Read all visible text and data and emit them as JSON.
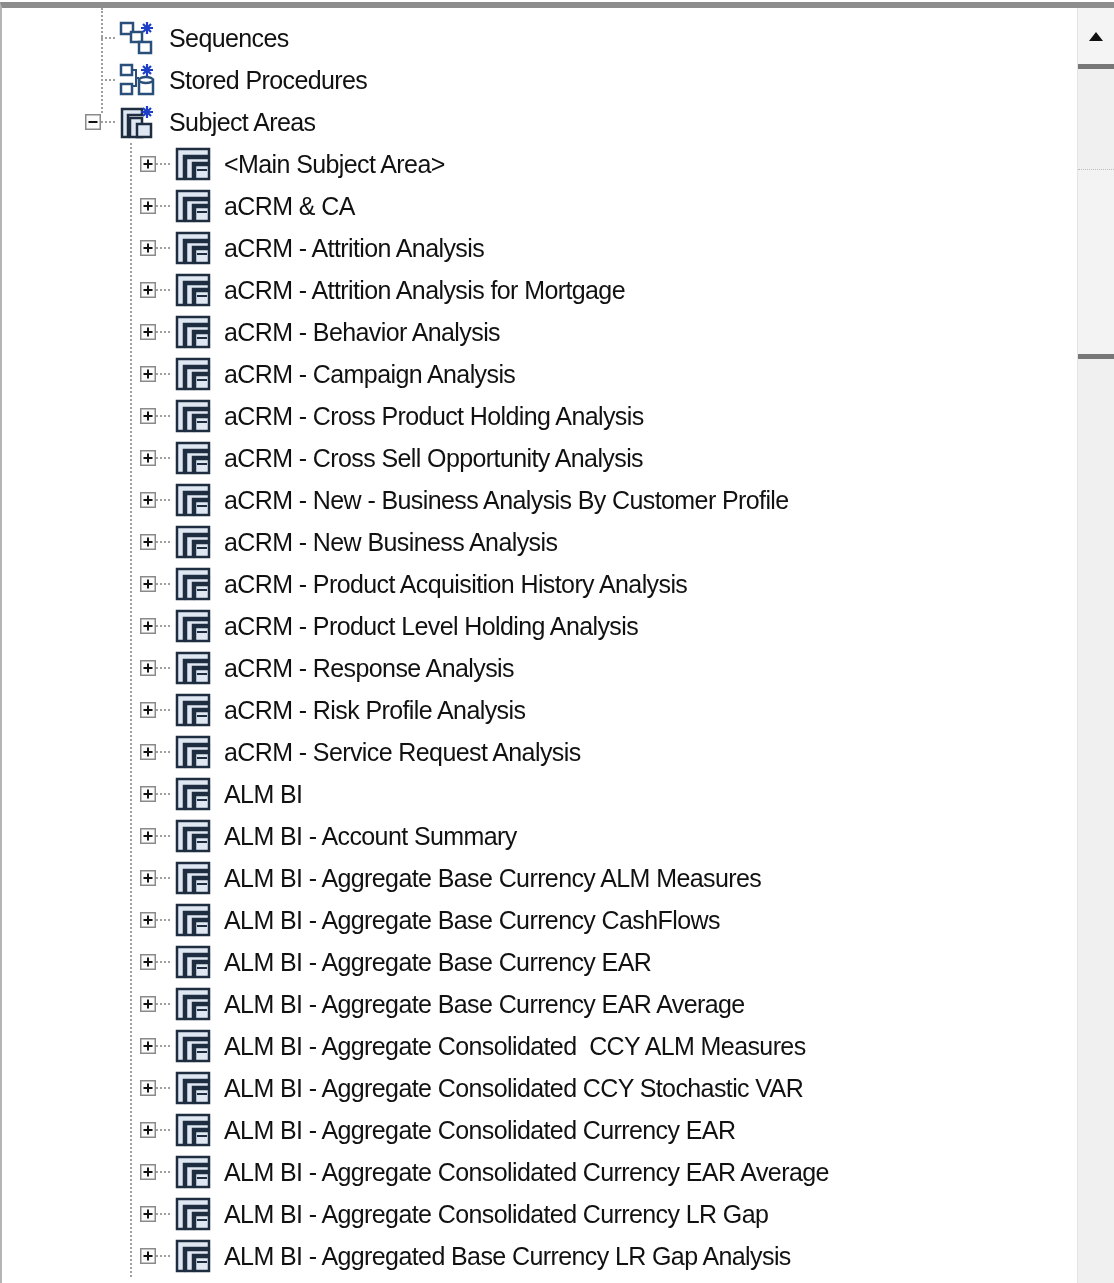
{
  "tree": {
    "items": [
      {
        "label": "Sequences",
        "kind": "sequences"
      },
      {
        "label": "Stored Procedures",
        "kind": "procedures"
      },
      {
        "label": "Subject Areas",
        "kind": "subject-folder",
        "expanded": true,
        "children": [
          {
            "label": "<Main Subject Area>",
            "kind": "subject-area",
            "expanded": false
          },
          {
            "label": "aCRM & CA",
            "kind": "subject-area",
            "expanded": false
          },
          {
            "label": "aCRM - Attrition Analysis",
            "kind": "subject-area",
            "expanded": false
          },
          {
            "label": "aCRM - Attrition Analysis for Mortgage",
            "kind": "subject-area",
            "expanded": false
          },
          {
            "label": "aCRM - Behavior Analysis",
            "kind": "subject-area",
            "expanded": false
          },
          {
            "label": "aCRM - Campaign Analysis",
            "kind": "subject-area",
            "expanded": false
          },
          {
            "label": "aCRM - Cross Product Holding Analysis",
            "kind": "subject-area",
            "expanded": false
          },
          {
            "label": "aCRM - Cross Sell Opportunity Analysis",
            "kind": "subject-area",
            "expanded": false
          },
          {
            "label": "aCRM - New - Business Analysis By Customer Profile",
            "kind": "subject-area",
            "expanded": false
          },
          {
            "label": "aCRM - New Business Analysis",
            "kind": "subject-area",
            "expanded": false
          },
          {
            "label": "aCRM - Product Acquisition History Analysis",
            "kind": "subject-area",
            "expanded": false
          },
          {
            "label": "aCRM - Product Level Holding Analysis",
            "kind": "subject-area",
            "expanded": false
          },
          {
            "label": "aCRM - Response Analysis",
            "kind": "subject-area",
            "expanded": false
          },
          {
            "label": "aCRM - Risk Profile Analysis",
            "kind": "subject-area",
            "expanded": false
          },
          {
            "label": "aCRM - Service Request Analysis",
            "kind": "subject-area",
            "expanded": false
          },
          {
            "label": "ALM BI",
            "kind": "subject-area",
            "expanded": false
          },
          {
            "label": "ALM BI - Account Summary",
            "kind": "subject-area",
            "expanded": false
          },
          {
            "label": "ALM BI - Aggregate Base Currency ALM Measures",
            "kind": "subject-area",
            "expanded": false
          },
          {
            "label": "ALM BI - Aggregate Base Currency CashFlows",
            "kind": "subject-area",
            "expanded": false
          },
          {
            "label": "ALM BI - Aggregate Base Currency EAR",
            "kind": "subject-area",
            "expanded": false
          },
          {
            "label": "ALM BI - Aggregate Base Currency EAR Average",
            "kind": "subject-area",
            "expanded": false
          },
          {
            "label": "ALM BI - Aggregate Consolidated  CCY ALM Measures",
            "kind": "subject-area",
            "expanded": false
          },
          {
            "label": "ALM BI - Aggregate Consolidated CCY Stochastic VAR",
            "kind": "subject-area",
            "expanded": false
          },
          {
            "label": "ALM BI - Aggregate Consolidated Currency EAR",
            "kind": "subject-area",
            "expanded": false
          },
          {
            "label": "ALM BI - Aggregate Consolidated Currency EAR Average",
            "kind": "subject-area",
            "expanded": false
          },
          {
            "label": "ALM BI - Aggregate Consolidated Currency LR Gap",
            "kind": "subject-area",
            "expanded": false
          },
          {
            "label": "ALM BI - Aggregated Base Currency LR Gap Analysis",
            "kind": "subject-area",
            "expanded": false
          }
        ]
      }
    ]
  }
}
